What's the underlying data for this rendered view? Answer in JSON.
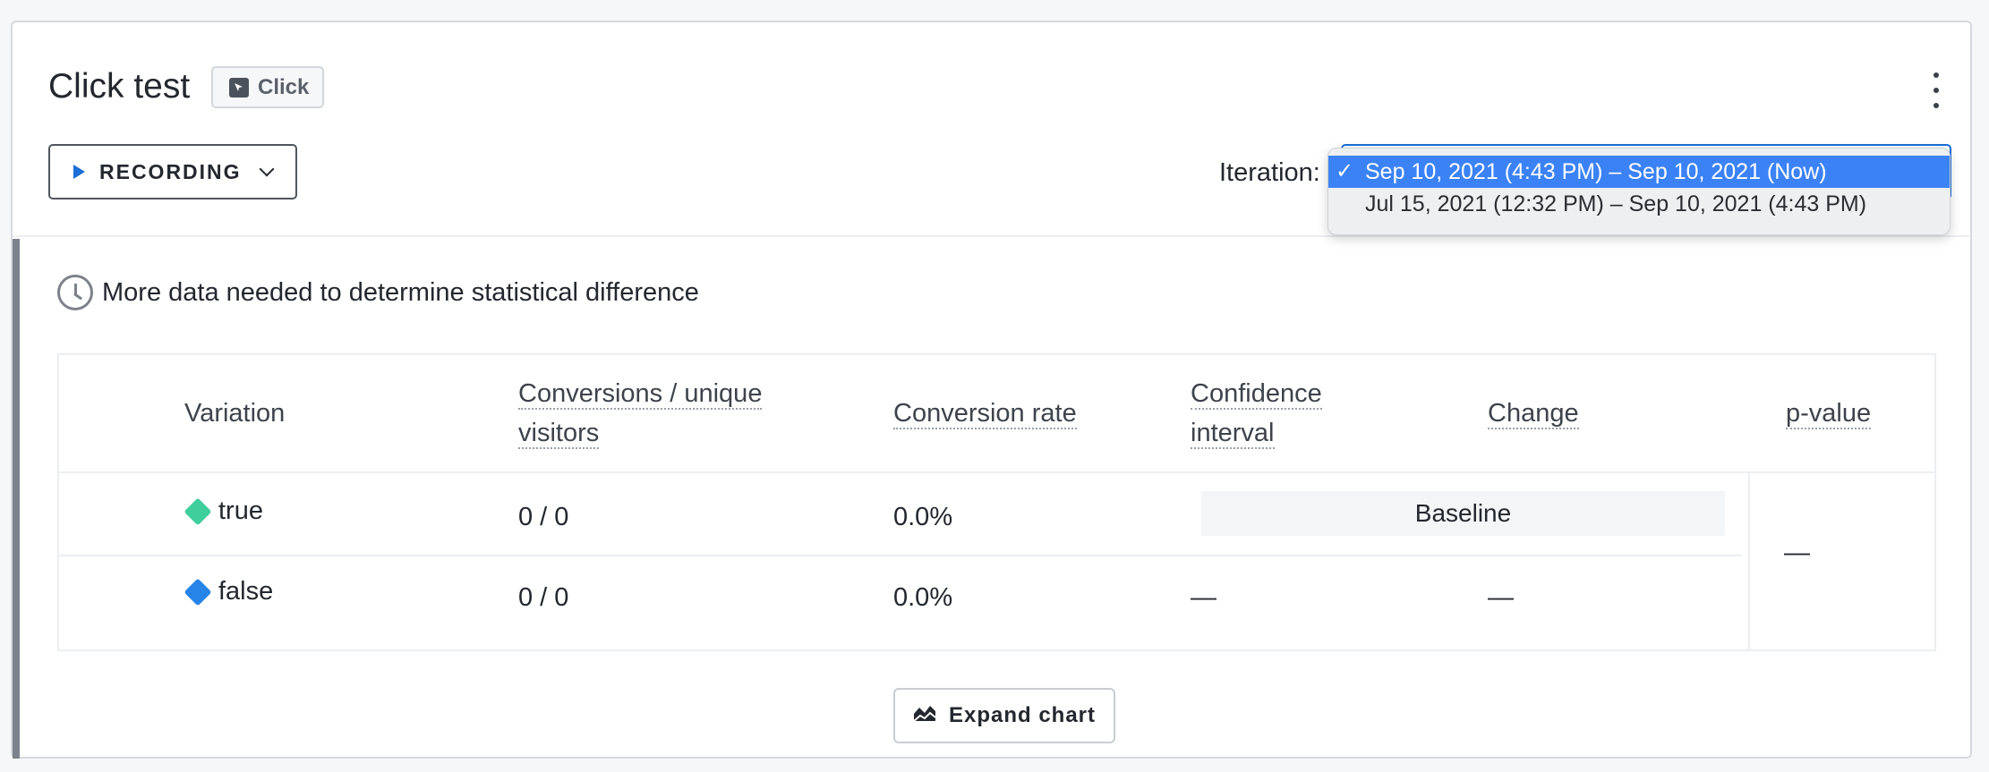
{
  "experiment": {
    "title": "Click test",
    "kind_badge": "Click"
  },
  "toolbar": {
    "recording_label": "RECORDING",
    "iteration_label": "Iteration:"
  },
  "iteration_dropdown": {
    "options": [
      {
        "label": "Sep 10, 2021 (4:43 PM) – Sep 10, 2021 (Now)",
        "selected": true
      },
      {
        "label": "Jul 15, 2021 (12:32 PM) – Sep 10, 2021 (4:43 PM)",
        "selected": false
      }
    ]
  },
  "status": {
    "message": "More data needed to determine statistical difference"
  },
  "table": {
    "headers": {
      "variation": "Variation",
      "conversions": "Conversions / unique visitors",
      "conversion_rate": "Conversion rate",
      "confidence": "Confidence interval",
      "change": "Change",
      "pvalue": "p-value"
    },
    "rows": [
      {
        "name": "true",
        "color": "#3ecf9d",
        "conversions": "0 / 0",
        "rate": "0.0%",
        "confidence": "Baseline",
        "change": ""
      },
      {
        "name": "false",
        "color": "#2684e8",
        "conversions": "0 / 0",
        "rate": "0.0%",
        "confidence": "—",
        "change": "—"
      }
    ],
    "pvalue": "—"
  },
  "expand_label": "Expand chart"
}
